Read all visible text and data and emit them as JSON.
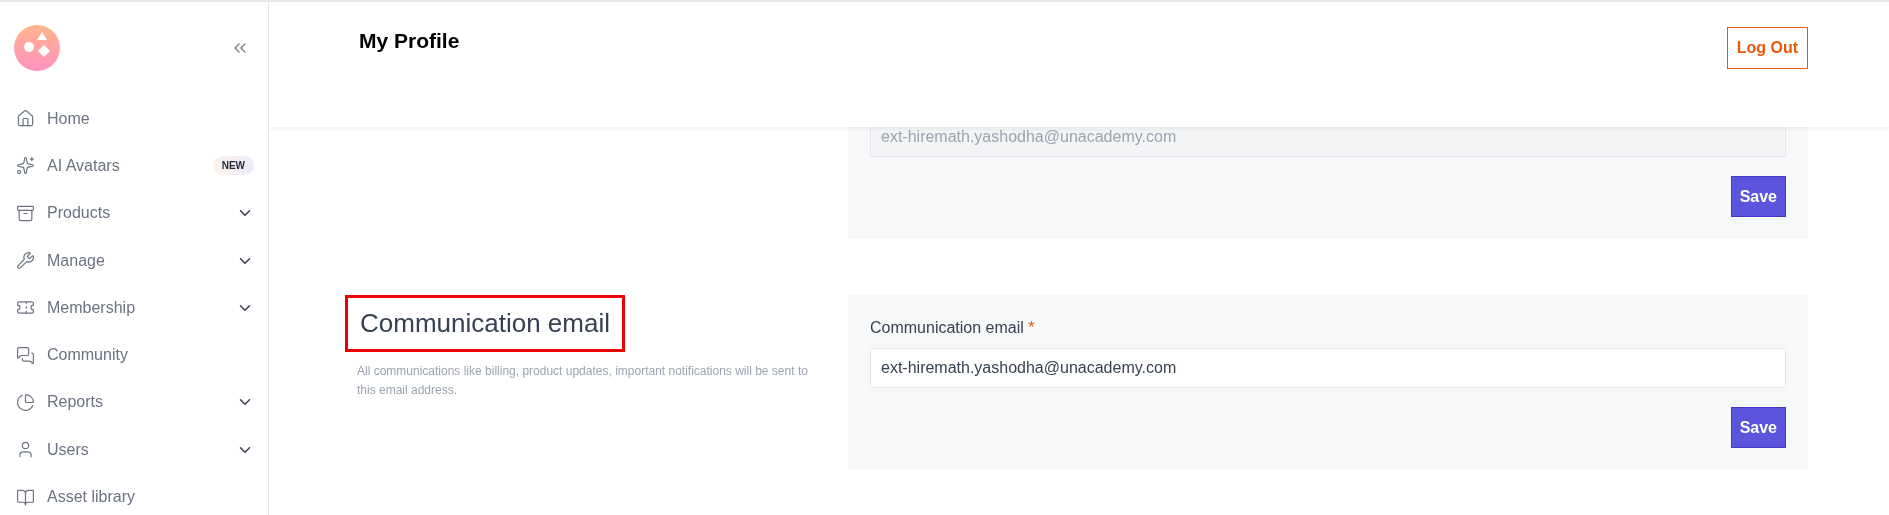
{
  "sidebar": {
    "items": [
      {
        "label": "Home",
        "expandable": false
      },
      {
        "label": "AI Avatars",
        "expandable": false,
        "badge": "NEW"
      },
      {
        "label": "Products",
        "expandable": true
      },
      {
        "label": "Manage",
        "expandable": true
      },
      {
        "label": "Membership",
        "expandable": true
      },
      {
        "label": "Community",
        "expandable": false
      },
      {
        "label": "Reports",
        "expandable": true
      },
      {
        "label": "Users",
        "expandable": true
      },
      {
        "label": "Asset library",
        "expandable": false
      }
    ]
  },
  "header": {
    "title": "My Profile",
    "logout": "Log Out"
  },
  "sections": [
    {
      "field": {
        "value": "ext-hiremath.yashodha@unacademy.com",
        "disabled": true
      },
      "save": "Save"
    },
    {
      "heading": "Communication email",
      "highlighted": true,
      "description": "All communications like billing, product updates, important notifications will be sent to this email address.",
      "field": {
        "label": "Communication email",
        "required": "*",
        "value": "ext-hiremath.yashodha@unacademy.com",
        "disabled": false
      },
      "save": "Save"
    }
  ]
}
